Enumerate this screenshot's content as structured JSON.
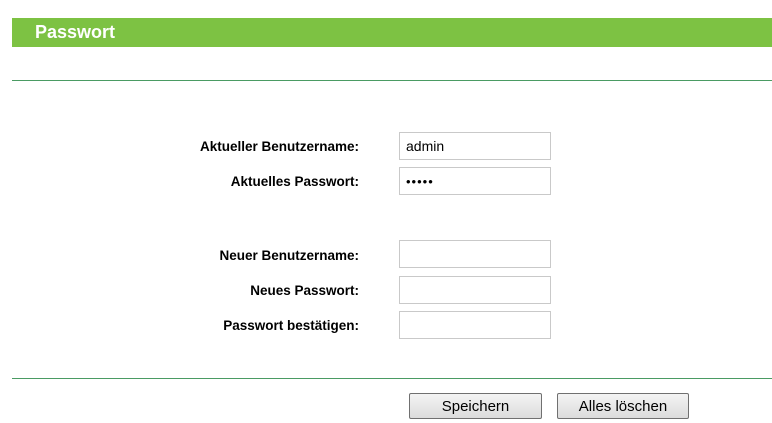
{
  "header": {
    "title": "Passwort"
  },
  "form": {
    "current_username": {
      "label": "Aktueller Benutzername:",
      "value": "admin"
    },
    "current_password": {
      "label": "Aktuelles Passwort:",
      "value": "admin"
    },
    "new_username": {
      "label": "Neuer Benutzername:",
      "value": ""
    },
    "new_password": {
      "label": "Neues Passwort:",
      "value": ""
    },
    "confirm_password": {
      "label": "Passwort bestätigen:",
      "value": ""
    }
  },
  "buttons": {
    "save_label": "Speichern",
    "clear_label": "Alles löschen"
  },
  "colors": {
    "header_bg": "#7dc243",
    "rule": "#4a9b63"
  }
}
